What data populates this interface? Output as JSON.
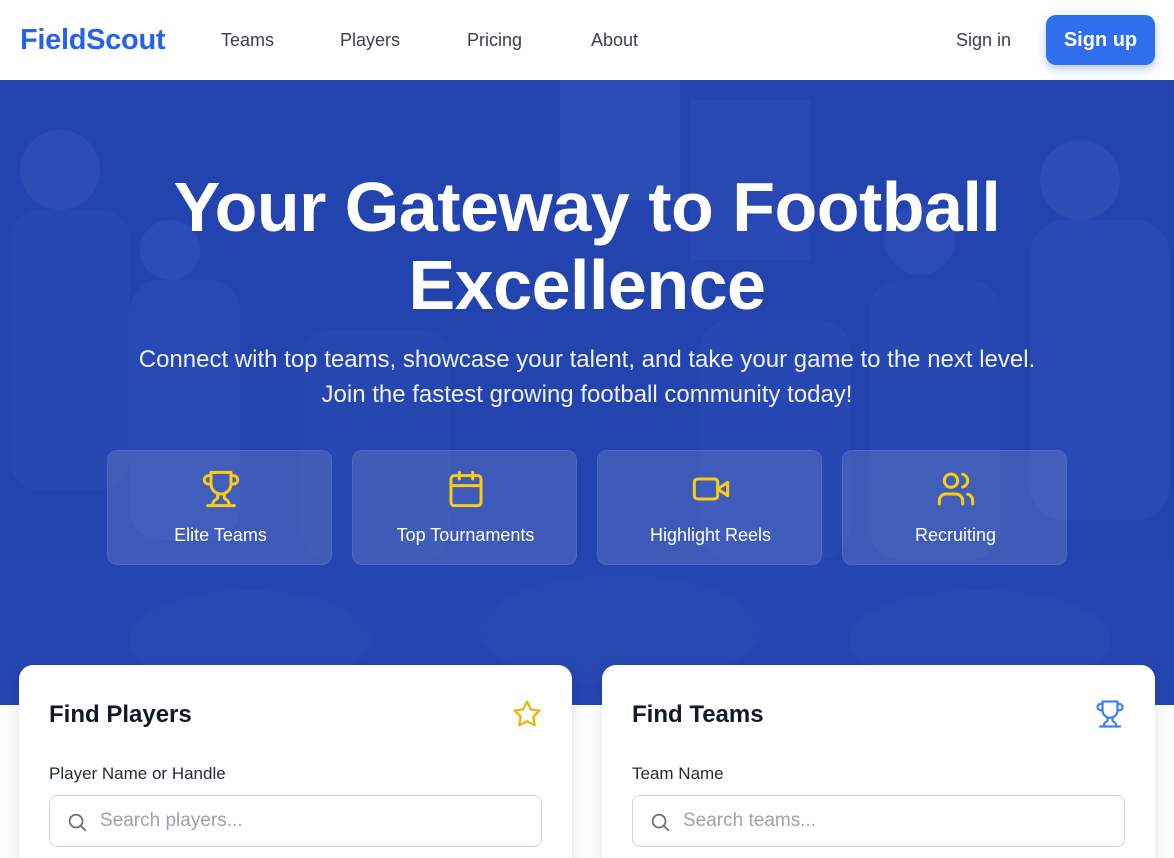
{
  "brand": {
    "name": "FieldScout",
    "color": "#2563eb"
  },
  "nav": {
    "links": [
      "Teams",
      "Players",
      "Pricing",
      "About"
    ],
    "signin": "Sign in",
    "signup": "Sign up"
  },
  "hero": {
    "title_line1": "Your Gateway to Football",
    "title_line2": "Excellence",
    "subtitle_line1": "Connect with top teams, showcase your talent, and take your game to the next level.",
    "subtitle_line2": "Join the fastest growing football community today!",
    "features": [
      {
        "label": "Elite Teams",
        "icon": "trophy-icon"
      },
      {
        "label": "Top Tournaments",
        "icon": "calendar-icon"
      },
      {
        "label": "Highlight Reels",
        "icon": "video-icon"
      },
      {
        "label": "Recruiting",
        "icon": "users-icon"
      }
    ],
    "accent_color": "#facc15"
  },
  "find_players": {
    "title": "Find Players",
    "icon": "star-icon",
    "field_label": "Player Name or Handle",
    "placeholder": "Search players..."
  },
  "find_teams": {
    "title": "Find Teams",
    "icon": "trophy-icon",
    "field_label": "Team Name",
    "placeholder": "Search teams..."
  }
}
